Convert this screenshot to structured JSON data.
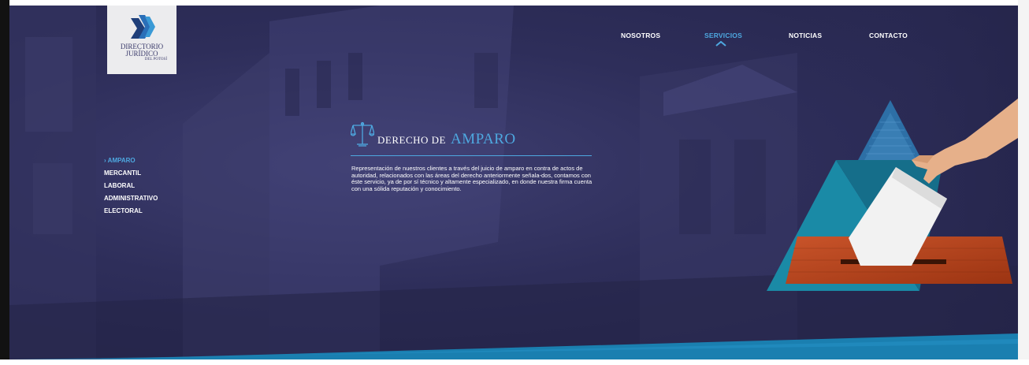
{
  "brand": {
    "line1": "DIRECTORIO",
    "line2": "JURÍDICO",
    "line3": "DEL POTOSÍ",
    "colors": {
      "dark": "#2e2e5a",
      "accent": "#4ea8e0",
      "teal": "#1a8aa6"
    }
  },
  "nav": {
    "items": [
      {
        "label": "NOSOTROS"
      },
      {
        "label": "SERVICIOS",
        "active": true
      },
      {
        "label": "NOTICIAS"
      },
      {
        "label": "CONTACTO"
      }
    ]
  },
  "sidebar": {
    "items": [
      {
        "label": "AMPARO",
        "active": true,
        "marker": "›"
      },
      {
        "label": "MERCANTIL"
      },
      {
        "label": "LABORAL"
      },
      {
        "label": "ADMINISTRATIVO"
      },
      {
        "label": "ELECTORAL"
      }
    ]
  },
  "content": {
    "title_prefix": "DERECHO DE",
    "title_main": "AMPARO",
    "icon": "scales-of-justice-icon",
    "description": "Representación de nuestros clientes a través del juicio de amparo en contra de actos de autoridad, relacionados con las áreas del derecho anteriormente señala-dos, contamos con éste servicio, ya de por sí técnico y altamente especializado, en donde nuestra firma cuenta con una sólida reputación y conocimiento."
  },
  "illustration": {
    "name": "ballot-box-illustration"
  }
}
